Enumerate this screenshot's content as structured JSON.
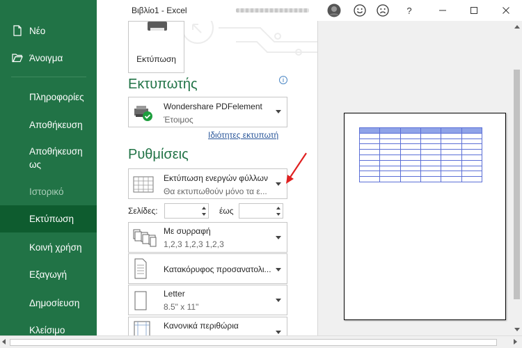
{
  "window": {
    "title": "Βιβλίο1  -  Excel"
  },
  "sidebar": {
    "items": [
      {
        "label": "Νέο",
        "icon": "new-document-icon"
      },
      {
        "label": "Άνοιγμα",
        "icon": "open-folder-icon"
      },
      {
        "label": "Πληροφορίες"
      },
      {
        "label": "Αποθήκευση"
      },
      {
        "label": "Αποθήκευση ως"
      },
      {
        "label": "Ιστορικό"
      },
      {
        "label": "Εκτύπωση"
      },
      {
        "label": "Κοινή χρήση"
      },
      {
        "label": "Εξαγωγή"
      },
      {
        "label": "Δημοσίευση"
      },
      {
        "label": "Κλείσιμο"
      }
    ]
  },
  "print": {
    "button_label": "Εκτύπωση",
    "printer_heading": "Εκτυπωτής",
    "printer_name": "Wondershare PDFelement",
    "printer_status": "Έτοιμος",
    "printer_properties_link": "Ιδιότητες εκτυπωτή",
    "settings_heading": "Ρυθμίσεις",
    "what_line1": "Εκτύπωση ενεργών φύλλων",
    "what_line2": "Θα εκτυπωθούν μόνο τα ε...",
    "pages_label": "Σελίδες:",
    "to_label": "έως",
    "collate_line1": "Με συρραφή",
    "collate_line2": "1,2,3    1,2,3    1,2,3",
    "orientation_line1": "Κατακόρυφος προσανατολι...",
    "paper_line1": "Letter",
    "paper_line2": "8.5\" x 11\"",
    "margins_line1": "Κανονικά περιθώρια"
  },
  "colors": {
    "accent": "#217346",
    "active": "#0e5c2f",
    "link": "#2b579a"
  }
}
